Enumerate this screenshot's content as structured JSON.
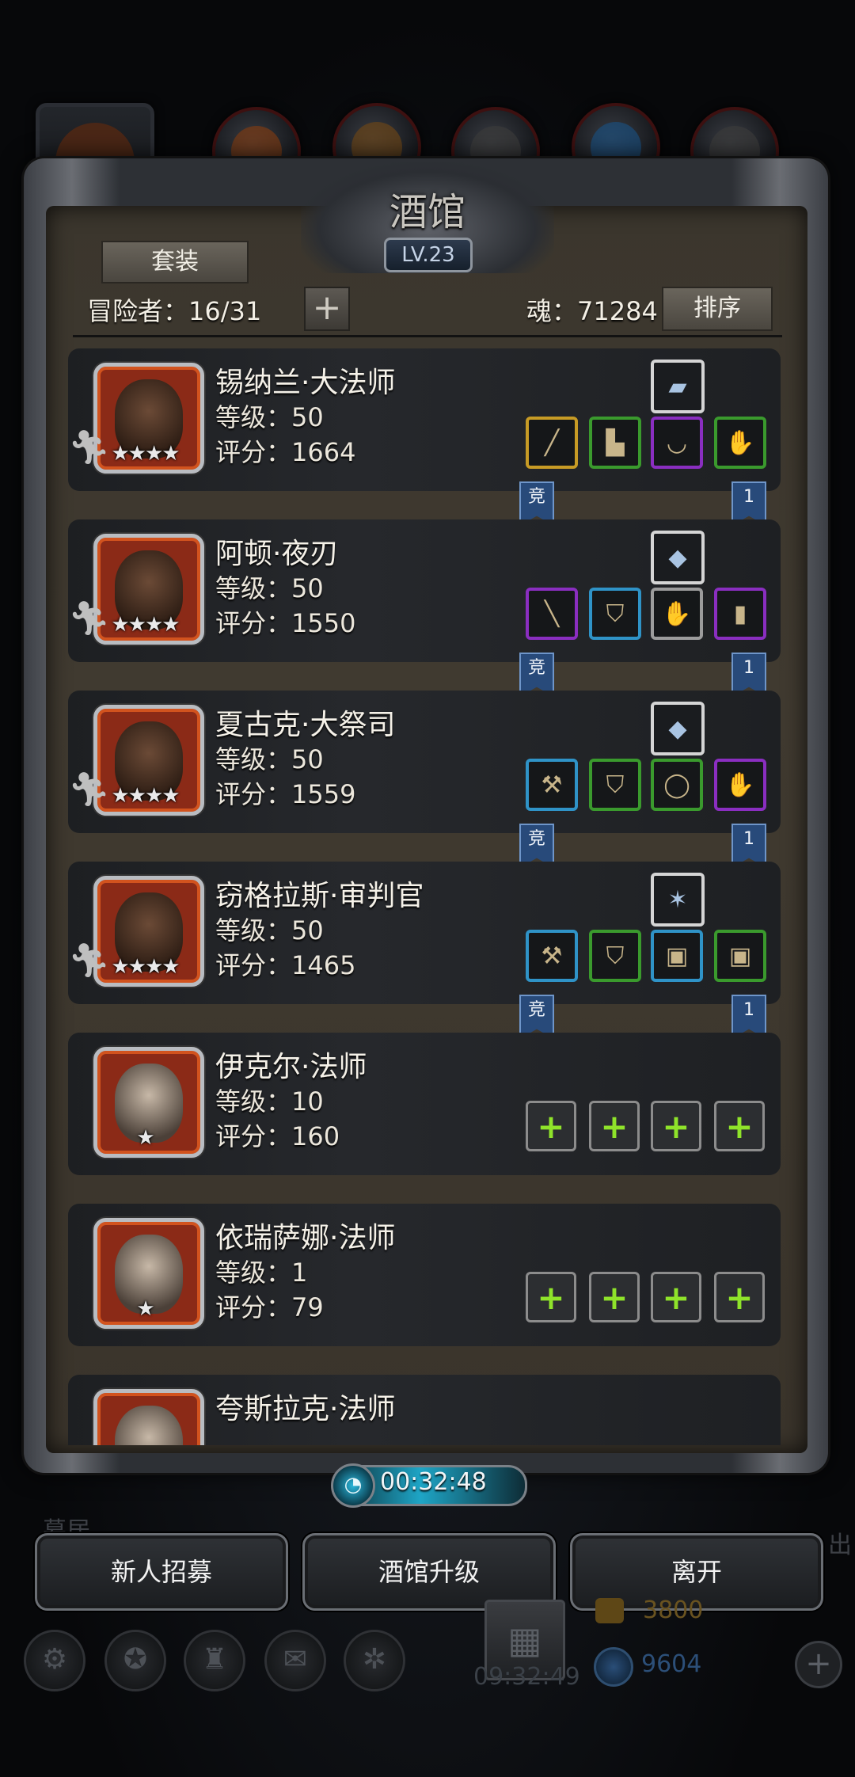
{
  "panel": {
    "title": "酒馆",
    "level": "LV.23",
    "set_button": "套装",
    "adventurer_label": "冒险者：16/31",
    "add_button": "+",
    "soul_label": "魂：71284",
    "sort_button": "排序"
  },
  "heroes": [
    {
      "name": "锡纳兰·大法师",
      "level": "等级：50",
      "score": "评分：1664",
      "stars": "★★★★",
      "artifact_icon": "blue-card-icon",
      "slots": [
        {
          "color": "gold",
          "icon": "staff-icon"
        },
        {
          "color": "green",
          "icon": "boots-icon"
        },
        {
          "color": "purple",
          "icon": "necklace-icon"
        },
        {
          "color": "green",
          "icon": "gauntlet-icon"
        }
      ],
      "badge_left": "竞",
      "badge_right": "1"
    },
    {
      "name": "阿顿·夜刃",
      "level": "等级：50",
      "score": "评分：1550",
      "stars": "★★★★",
      "artifact_icon": "crystal-icon",
      "slots": [
        {
          "color": "purple",
          "icon": "dagger-icon"
        },
        {
          "color": "blue",
          "icon": "armor-icon"
        },
        {
          "color": "gray",
          "icon": "gauntlet-icon"
        },
        {
          "color": "purple",
          "icon": "shield-icon"
        }
      ],
      "badge_left": "竞",
      "badge_right": "1"
    },
    {
      "name": "夏古克·大祭司",
      "level": "等级：50",
      "score": "评分：1559",
      "stars": "★★★★",
      "artifact_icon": "crystal-icon",
      "slots": [
        {
          "color": "blue",
          "icon": "hammer-icon"
        },
        {
          "color": "green",
          "icon": "armor-icon"
        },
        {
          "color": "green",
          "icon": "ring-icon"
        },
        {
          "color": "purple",
          "icon": "gauntlet-icon"
        }
      ],
      "badge_left": "竞",
      "badge_right": "1"
    },
    {
      "name": "窃格拉斯·审判官",
      "level": "等级：50",
      "score": "评分：1465",
      "stars": "★★★★",
      "artifact_icon": "emblem-icon",
      "slots": [
        {
          "color": "blue",
          "icon": "hammer-icon"
        },
        {
          "color": "green",
          "icon": "armor-icon"
        },
        {
          "color": "blue",
          "icon": "chest-armor-icon"
        },
        {
          "color": "green",
          "icon": "chest-armor-icon"
        }
      ],
      "badge_left": "竞",
      "badge_right": "1"
    },
    {
      "name": "伊克尔·法师",
      "level": "等级：10",
      "score": "评分：160",
      "stars": "★",
      "slots": [
        {
          "color": "empty"
        },
        {
          "color": "empty"
        },
        {
          "color": "empty"
        },
        {
          "color": "empty"
        }
      ]
    },
    {
      "name": "依瑞萨娜·法师",
      "level": "等级：1",
      "score": "评分：79",
      "stars": "★",
      "slots": [
        {
          "color": "empty"
        },
        {
          "color": "empty"
        },
        {
          "color": "empty"
        },
        {
          "color": "empty"
        }
      ]
    },
    {
      "name": "夸斯拉克·法师",
      "level": "",
      "score": "",
      "stars": "",
      "slots": []
    }
  ],
  "timer": "00:32:48",
  "actions": {
    "recruit": "新人招募",
    "upgrade": "酒馆升级",
    "leave": "离开"
  },
  "background": {
    "left_label": "募居",
    "right_label": "出",
    "gift_timer": "09:32:49",
    "gold": "3800",
    "gems": "9604"
  },
  "colors": {
    "slot_gold": "#c79b25",
    "slot_green": "#3a9a2d",
    "slot_purple": "#8a2ec0",
    "slot_blue": "#2f93c7",
    "slot_empty_plus": "#8fe32a",
    "badge_blue": "#284a7a"
  }
}
